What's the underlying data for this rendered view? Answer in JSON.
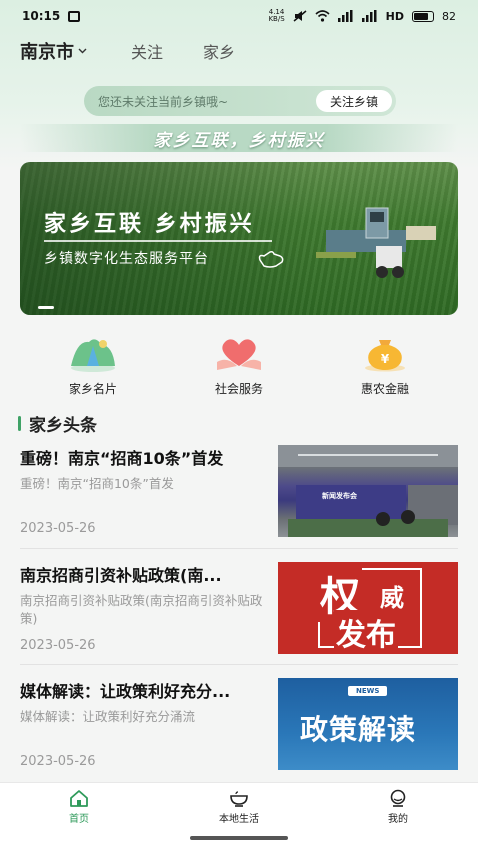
{
  "status_bar": {
    "time": "10:15",
    "net_speed_value": "4.14",
    "net_speed_unit": "KB/S",
    "hd_label": "HD",
    "battery": "82"
  },
  "header": {
    "city": "南京市",
    "tabs": [
      "关注",
      "家乡"
    ]
  },
  "notice": {
    "text": "您还未关注当前乡镇哦~",
    "button": "关注乡镇"
  },
  "slogan": "家乡互联，乡村振兴",
  "banner": {
    "title": "家乡互联 乡村振兴",
    "subtitle": "乡镇数字化生态服务平台"
  },
  "services": [
    {
      "label": "家乡名片",
      "icon": "mountain-card-icon"
    },
    {
      "label": "社会服务",
      "icon": "heart-hands-icon"
    },
    {
      "label": "惠农金融",
      "icon": "money-bag-icon"
    }
  ],
  "section_title": "家乡头条",
  "news": [
    {
      "title": "重磅！南京“招商10条”首发",
      "desc": "重磅！南京“招商10条”首发",
      "date": "2023-05-26",
      "thumb_caption": "新闻发布会"
    },
    {
      "title": "南京招商引资补贴政策(南...",
      "desc": "南京招商引资补贴政策(南京招商引资补贴政策)",
      "date": "2023-05-26",
      "thumb_text_1": "权",
      "thumb_text_2": "威",
      "thumb_text_3": "发布"
    },
    {
      "title": "媒体解读：让政策利好充分...",
      "desc": "媒体解读：让政策利好充分涌流",
      "date": "2023-05-26",
      "thumb_badge": "NEWS",
      "thumb_text": "政策解读"
    }
  ],
  "bottom_nav": [
    {
      "label": "首页",
      "icon": "home-icon",
      "active": true
    },
    {
      "label": "本地生活",
      "icon": "bowl-icon",
      "active": false
    },
    {
      "label": "我的",
      "icon": "profile-icon",
      "active": false
    }
  ],
  "colors": {
    "accent": "#2e9a5a",
    "section_bar": "#3fa266",
    "red_thumb": "#c42c26",
    "blue_thumb": "#1e5fa0"
  }
}
